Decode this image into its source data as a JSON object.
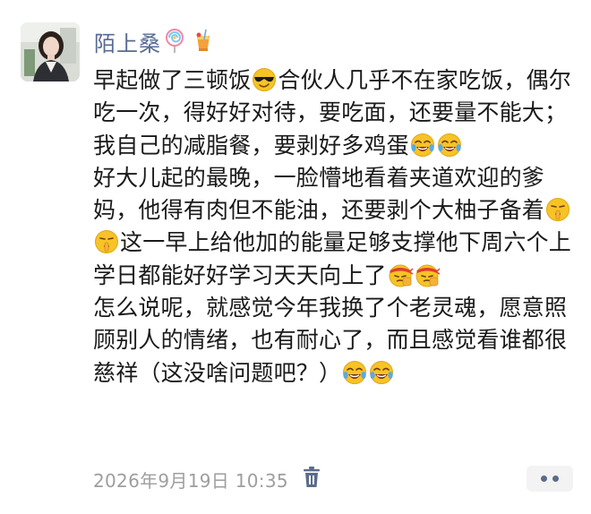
{
  "user": {
    "name": "陌上桑",
    "avatar_icon": "woman-portrait-avatar",
    "name_emojis": [
      "lollipop-icon",
      "cocktail-icon"
    ]
  },
  "post": {
    "p1": {
      "t1": "早起做了三顿饭",
      "t2": "合伙人几乎不在家吃饭，偶尔吃一次，得好好对待，要吃面，还要量不能大；我自己的减脂餐，要剥好多鸡蛋"
    },
    "p2": {
      "t1": "好大儿起的最晚，一脸懵地看着夹道欢迎的爹妈，他得有肉但不能油，还要剥个大柚子备着",
      "t2": "这一早上给他加的能量足够支撑他下周六个上学日都能好好学习天天向上了"
    },
    "p3": {
      "t1": "怎么说呢，就感觉今年我换了个老灵魂，愿意照顾别人的情绪，也有耐心了，而且感觉看谁都很慈祥（这没啥问题吧？）"
    },
    "emoji_names": [
      "sunglasses-emoji",
      "tears-of-joy-emoji",
      "shushing-emoji",
      "headband-fist-emoji"
    ]
  },
  "footer": {
    "timestamp": "2026年9月19日 10:35",
    "delete_icon": "trash-icon",
    "more_icon": "more-dots-icon"
  },
  "colors": {
    "username": "#576b95",
    "timestamp": "#9e9e9e",
    "text": "#1a1a1a",
    "more_bg": "#f3f3f3"
  }
}
